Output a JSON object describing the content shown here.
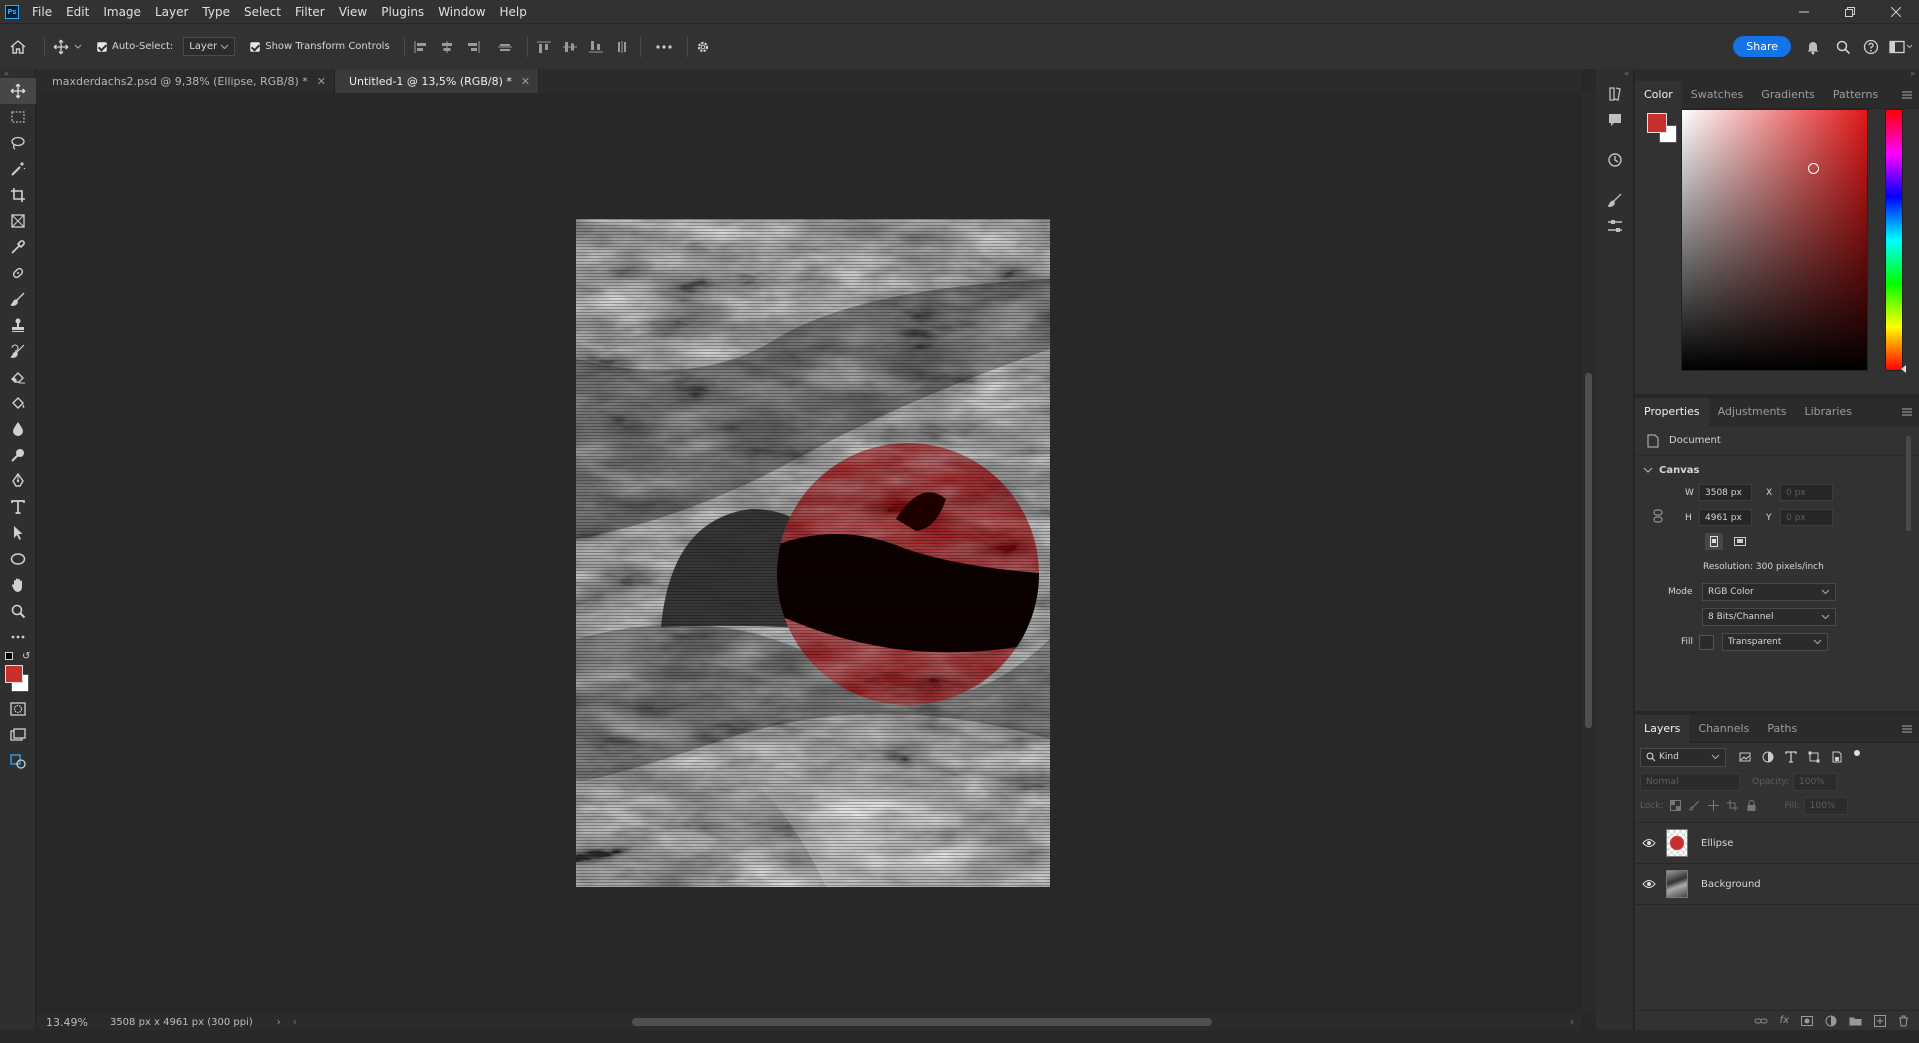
{
  "app": {
    "logo": "Ps",
    "menu": [
      "File",
      "Edit",
      "Image",
      "Layer",
      "Type",
      "Select",
      "Filter",
      "View",
      "Plugins",
      "Window",
      "Help"
    ]
  },
  "options": {
    "auto_select_label": "Auto-Select:",
    "auto_select_value": "Layer",
    "transform_label": "Show Transform Controls",
    "share_label": "Share"
  },
  "tabs": [
    {
      "label": "maxderdachs2.psd @ 9,38% (Ellipse, RGB/8) *"
    },
    {
      "label": "Untitled-1 @ 13,5% (RGB/8) *"
    }
  ],
  "status": {
    "zoom": "13.49%",
    "info": "3508 px x 4961 px (300 ppi)"
  },
  "colors": {
    "foreground": "#c8302f",
    "background": "#ffffff",
    "accent": "#1473e6",
    "circle": "#8e0d10"
  },
  "color_panel": {
    "tabs": [
      "Color",
      "Swatches",
      "Gradients",
      "Patterns"
    ],
    "hue": "#e01818"
  },
  "properties": {
    "tabs": [
      "Properties",
      "Adjustments",
      "Libraries"
    ],
    "doc_label": "Document",
    "section": "Canvas",
    "w_label": "W",
    "w_value": "3508 px",
    "h_label": "H",
    "h_value": "4961 px",
    "x_label": "X",
    "x_value": "0 px",
    "y_label": "Y",
    "y_value": "0 px",
    "resolution": "Resolution: 300 pixels/inch",
    "mode_label": "Mode",
    "mode_value": "RGB Color",
    "depth_value": "8 Bits/Channel",
    "fill_label": "Fill",
    "fill_value": "Transparent"
  },
  "layers_panel": {
    "tabs": [
      "Layers",
      "Channels",
      "Paths"
    ],
    "kind": "Kind",
    "blend": "Normal",
    "opacity_label": "Opacity:",
    "opacity_value": "100%",
    "lock_label": "Lock:",
    "fill_label": "Fill:",
    "fill_value": "100%",
    "layers": [
      {
        "name": "Ellipse"
      },
      {
        "name": "Background"
      }
    ]
  }
}
